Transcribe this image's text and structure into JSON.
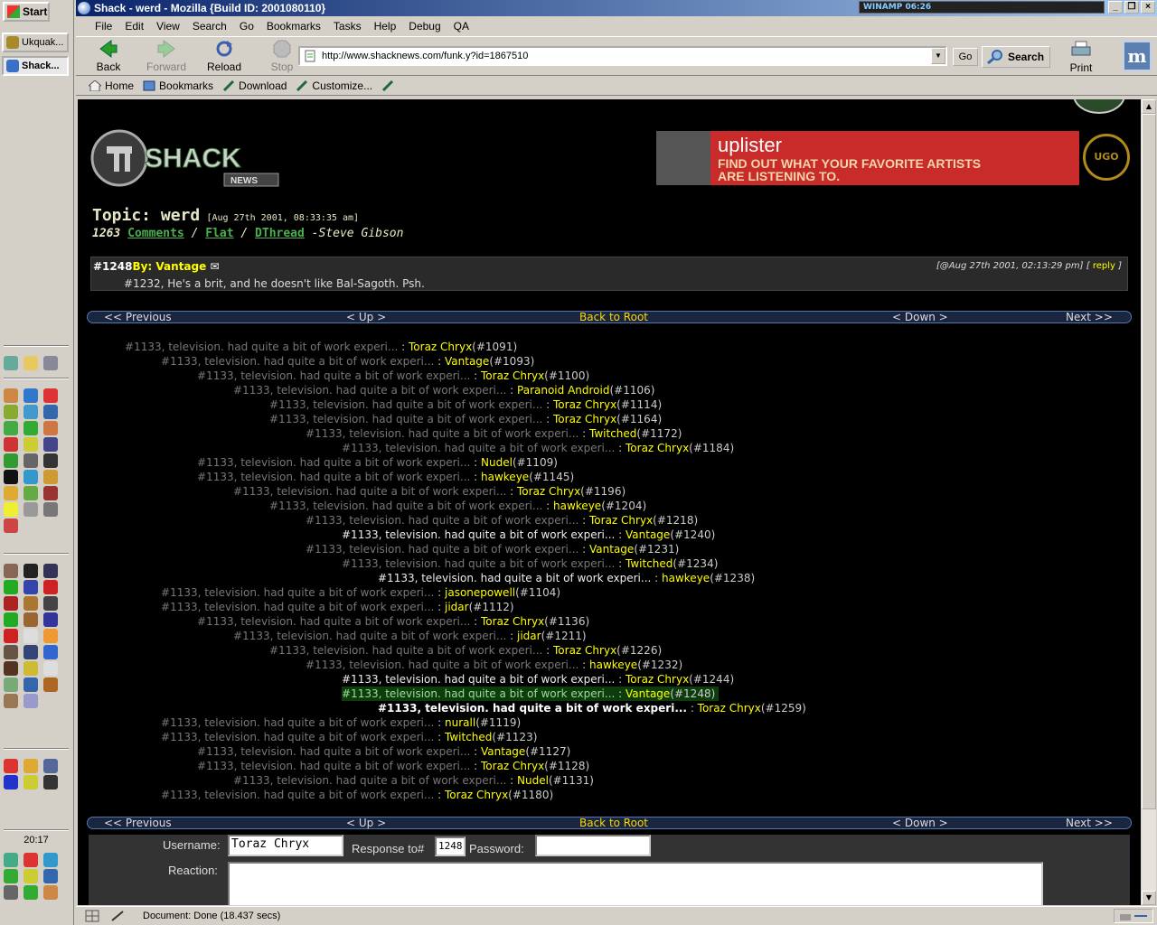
{
  "taskbar": {
    "start_label": "Start",
    "tasks": [
      {
        "label": "Ukquak..."
      },
      {
        "label": "Shack..."
      }
    ],
    "clock": "20:17"
  },
  "window": {
    "title": "Shack - werd - Mozilla {Build ID: 2001080110}",
    "winamp": "WINAMP   06:26"
  },
  "menu": [
    "File",
    "Edit",
    "View",
    "Search",
    "Go",
    "Bookmarks",
    "Tasks",
    "Help",
    "Debug",
    "QA"
  ],
  "nav": {
    "back": "Back",
    "forward": "Forward",
    "reload": "Reload",
    "stop": "Stop",
    "url": "http://www.shacknews.com/funk.y?id=1867510",
    "go": "Go",
    "search": "Search",
    "print": "Print"
  },
  "personal_bar": {
    "home": "Home",
    "bookmarks": "Bookmarks",
    "download": "Download",
    "customize": "Customize..."
  },
  "page": {
    "banner_title": "uplister",
    "banner_tagline_1": "FIND OUT WHAT YOUR FAVORITE ARTISTS",
    "banner_tagline_2": "ARE LISTENING TO.",
    "ugo": "UGO",
    "topic_prefix": "Topic: werd",
    "topic_date": "[Aug 27th 2001, 08:33:35 am]",
    "comment_count": "1263",
    "comments_link": "Comments",
    "flat_link": "Flat",
    "dthread_link": "DThread",
    "author": "-Steve Gibson",
    "post": {
      "id": "#1248",
      "by_label": "By:",
      "author": "Vantage",
      "timestamp": "[@Aug 27th 2001, 02:13:29 pm]",
      "reply": "reply",
      "body": "#1232, He's a brit, and he doesn't like Bal-Sagoth. Psh."
    },
    "nav_strip": {
      "previous": "<< Previous",
      "up": "< Up >",
      "root": "Back to Root",
      "down": "< Down >",
      "next": "Next >>"
    },
    "thread_text": "#1133, television. had quite a bit of work experi...",
    "thread": [
      {
        "indent": 0,
        "name": "Toraz Chryx",
        "id": "(#1091)",
        "style": "dim"
      },
      {
        "indent": 1,
        "name": "Vantage",
        "id": "(#1093)",
        "style": "dim"
      },
      {
        "indent": 2,
        "name": "Toraz Chryx",
        "id": "(#1100)",
        "style": "dim"
      },
      {
        "indent": 3,
        "name": "Paranoid Android",
        "id": "(#1106)",
        "style": "dim"
      },
      {
        "indent": 4,
        "name": "Toraz Chryx",
        "id": "(#1114)",
        "style": "dim"
      },
      {
        "indent": 4,
        "name": "Toraz Chryx",
        "id": "(#1164)",
        "style": "dim"
      },
      {
        "indent": 5,
        "name": "Twitched",
        "id": "(#1172)",
        "style": "dim"
      },
      {
        "indent": 6,
        "name": "Toraz Chryx",
        "id": "(#1184)",
        "style": "dim"
      },
      {
        "indent": 2,
        "name": "Nudel",
        "id": "(#1109)",
        "style": "dim"
      },
      {
        "indent": 2,
        "name": "hawkeye",
        "id": "(#1145)",
        "style": "dim"
      },
      {
        "indent": 3,
        "name": "Toraz Chryx",
        "id": "(#1196)",
        "style": "dim"
      },
      {
        "indent": 4,
        "name": "hawkeye",
        "id": "(#1204)",
        "style": "dim"
      },
      {
        "indent": 5,
        "name": "Toraz Chryx",
        "id": "(#1218)",
        "style": "dim"
      },
      {
        "indent": 6,
        "name": "Vantage",
        "id": "(#1240)",
        "style": "bright"
      },
      {
        "indent": 5,
        "name": "Vantage",
        "id": "(#1231)",
        "style": "dim"
      },
      {
        "indent": 6,
        "name": "Twitched",
        "id": "(#1234)",
        "style": "dim"
      },
      {
        "indent": 7,
        "name": "hawkeye",
        "id": "(#1238)",
        "style": "bright"
      },
      {
        "indent": 1,
        "name": "jasonepowell",
        "id": "(#1104)",
        "style": "dim"
      },
      {
        "indent": 1,
        "name": "jidar",
        "id": "(#1112)",
        "style": "dim"
      },
      {
        "indent": 2,
        "name": "Toraz Chryx",
        "id": "(#1136)",
        "style": "dim"
      },
      {
        "indent": 3,
        "name": "jidar",
        "id": "(#1211)",
        "style": "dim"
      },
      {
        "indent": 4,
        "name": "Toraz Chryx",
        "id": "(#1226)",
        "style": "dim"
      },
      {
        "indent": 5,
        "name": "hawkeye",
        "id": "(#1232)",
        "style": "dim"
      },
      {
        "indent": 6,
        "name": "Toraz Chryx",
        "id": "(#1244)",
        "style": "bright"
      },
      {
        "indent": 6,
        "name": "Vantage",
        "id": "(#1248)",
        "style": "current"
      },
      {
        "indent": 7,
        "name": "Toraz Chryx",
        "id": "(#1259)",
        "style": "bold"
      },
      {
        "indent": 1,
        "name": "nurall",
        "id": "(#1119)",
        "style": "dim"
      },
      {
        "indent": 1,
        "name": "Twitched",
        "id": "(#1123)",
        "style": "dim"
      },
      {
        "indent": 2,
        "name": "Vantage",
        "id": "(#1127)",
        "style": "dim"
      },
      {
        "indent": 2,
        "name": "Toraz Chryx",
        "id": "(#1128)",
        "style": "dim"
      },
      {
        "indent": 3,
        "name": "Nudel",
        "id": "(#1131)",
        "style": "dim"
      },
      {
        "indent": 1,
        "name": "Toraz Chryx",
        "id": "(#1180)",
        "style": "dim"
      }
    ],
    "form": {
      "username_label": "Username:",
      "username_value": "Toraz Chryx",
      "response_label": "Response to#",
      "response_value": "1248",
      "password_label": "Password:",
      "reaction_label": "Reaction:"
    }
  },
  "status": {
    "text": "Document: Done (18.437 secs)"
  }
}
